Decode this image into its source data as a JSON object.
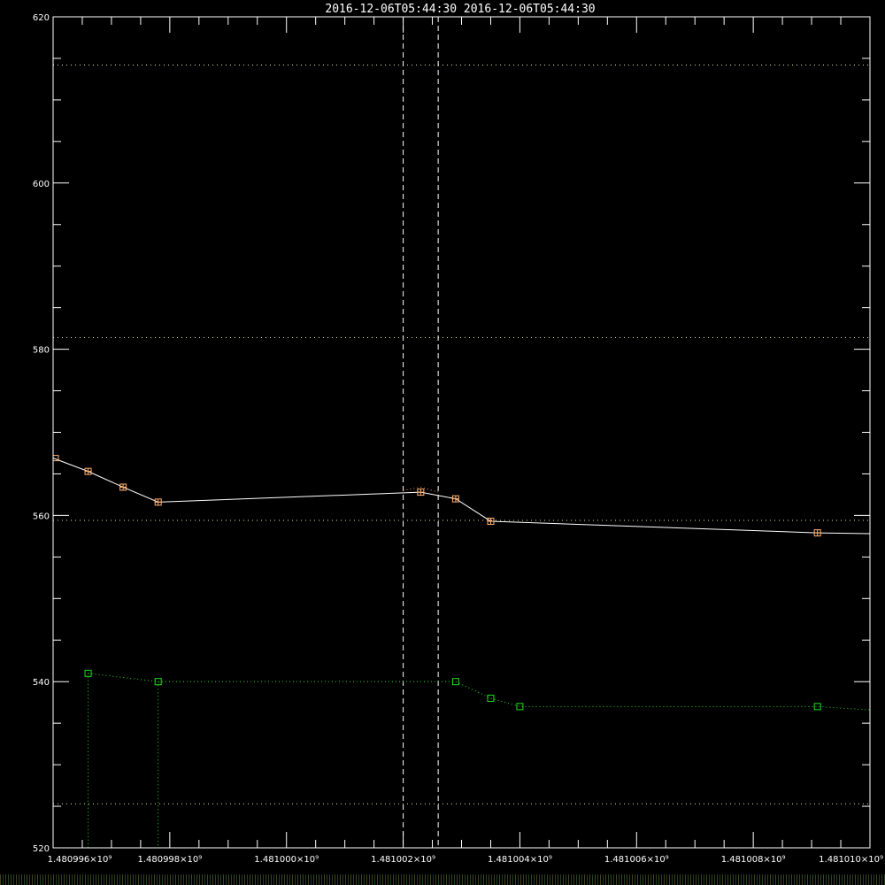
{
  "chart_data": {
    "type": "line",
    "title": "2016-12-06T05:44:30  2016-12-06T05:44:30",
    "xlabel": "",
    "ylabel": "",
    "xlim": [
      1480996000,
      1481010000
    ],
    "ylim": [
      520,
      620
    ],
    "x_ticks": [
      1480996000,
      1480998000,
      1481000000,
      1481002000,
      1481004000,
      1481006000,
      1481008000,
      1481010000
    ],
    "x_tick_labels": [
      "1.480996×10⁹",
      "1.480998×10⁹",
      "1.481000×10⁹",
      "1.481002×10⁹",
      "1.481004×10⁹",
      "1.481006×10⁹",
      "1.481008×10⁹",
      "1.481010×10⁹"
    ],
    "y_ticks": [
      520,
      540,
      560,
      580,
      600,
      620
    ],
    "y_tick_labels": [
      "520",
      "540",
      "560",
      "580",
      "600",
      "620"
    ],
    "y_minor_step": 5,
    "x_minor_step": 500,
    "horizontal_dotted_refs": [
      614.2,
      581.4,
      559.4,
      525.3
    ],
    "vertical_dashed_markers": [
      1481002000,
      1481002600
    ],
    "series": [
      {
        "color": "#ffffff",
        "line": "solid",
        "marker": "square-plus",
        "marker_color": "#ffb070",
        "x": [
          1480996000,
          1480996600,
          1480997200,
          1480997800,
          1481002300,
          1481002900,
          1481003500,
          1481009100,
          1481010000
        ],
        "y": [
          566.9,
          565.3,
          563.4,
          561.6,
          562.8,
          562.0,
          559.3,
          557.9,
          557.8
        ]
      },
      {
        "color": "#ff9a40",
        "line": "dotted",
        "marker": "none",
        "x": [
          1481002000,
          1481002300,
          1481002600
        ],
        "y": [
          563.0,
          563.4,
          562.8
        ]
      },
      {
        "color": "#22dd22",
        "line": "dotted",
        "marker": "square",
        "x": [
          1480996600,
          1480997800,
          1481002900,
          1481003500,
          1481004000,
          1481009100,
          1481010000
        ],
        "y": [
          541.0,
          540.0,
          540.0,
          538.0,
          537.0,
          537.0,
          536.6
        ],
        "drops_to_axis_at": [
          1480996600,
          1480997800
        ]
      }
    ]
  }
}
